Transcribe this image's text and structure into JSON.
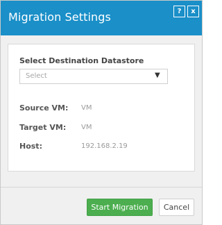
{
  "window": {
    "title": "Migration Settings",
    "help_label": "?",
    "close_label": "x"
  },
  "form": {
    "datastore_label": "Select Destination Datastore",
    "datastore_placeholder": "Select",
    "datastore_arrow": "▼",
    "source_vm_label": "Source VM:",
    "source_vm_value": "VM",
    "target_vm_label": "Target VM:",
    "target_vm_value": "VM",
    "host_label": "Host:",
    "host_value": "192.168.2.19"
  },
  "footer": {
    "start_label": "Start Migration",
    "cancel_label": "Cancel"
  },
  "colors": {
    "titlebar": "#1a8fc8",
    "primary_button": "#4cae4f"
  }
}
